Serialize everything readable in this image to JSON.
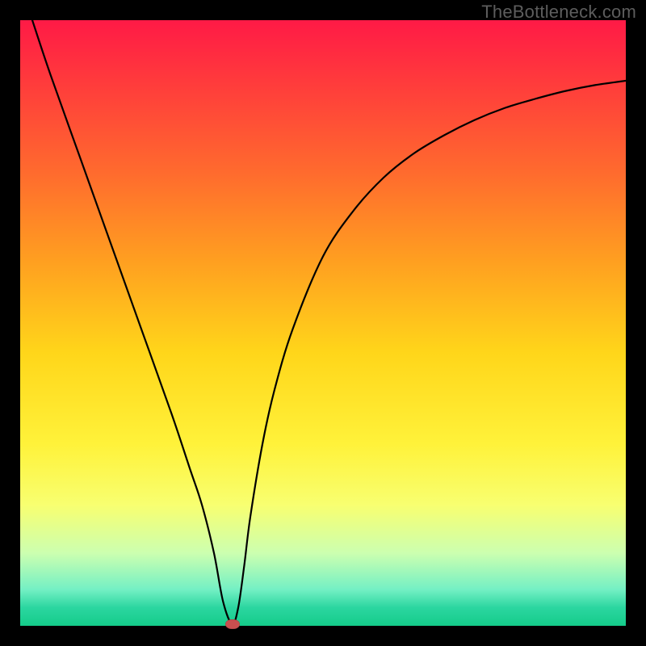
{
  "watermark": "TheBottleneck.com",
  "chart_data": {
    "type": "line",
    "title": "",
    "xlabel": "",
    "ylabel": "",
    "xlim": [
      0,
      100
    ],
    "ylim": [
      0,
      100
    ],
    "grid": false,
    "legend": false,
    "series": [
      {
        "name": "bottleneck-curve",
        "x": [
          2,
          5,
          10,
          15,
          20,
          25,
          28,
          30,
          32,
          33.5,
          35,
          36,
          37,
          38,
          40,
          42,
          45,
          50,
          55,
          60,
          65,
          70,
          75,
          80,
          85,
          90,
          95,
          100
        ],
        "values": [
          100,
          91,
          77,
          63,
          49,
          35,
          26,
          20,
          12,
          4,
          0.3,
          3,
          10,
          18,
          30,
          39,
          49,
          61,
          68.5,
          74,
          78,
          81,
          83.5,
          85.5,
          87,
          88.3,
          89.3,
          90
        ]
      }
    ],
    "marker": {
      "x": 35,
      "y": 0.3,
      "color": "#c94f4f"
    },
    "background_gradient": [
      "#ff1a46",
      "#ffd61a",
      "#f8ff70",
      "#14cc8a"
    ]
  }
}
